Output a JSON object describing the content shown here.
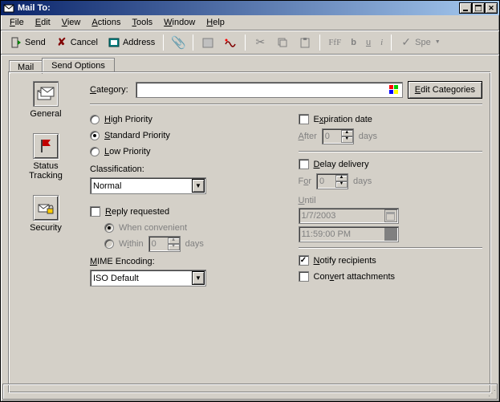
{
  "title": "Mail To:",
  "menu": {
    "file": "File",
    "edit": "Edit",
    "view": "View",
    "actions": "Actions",
    "tools": "Tools",
    "window": "Window",
    "help": "Help"
  },
  "toolbar": {
    "send": "Send",
    "cancel": "Cancel",
    "address": "Address",
    "spell": "Spe"
  },
  "tabs": {
    "mail": "Mail",
    "send_options": "Send Options"
  },
  "sidenav": {
    "general": "General",
    "status": "Status Tracking",
    "security": "Security"
  },
  "category": {
    "label": "Category:",
    "value": "",
    "edit": "Edit Categories"
  },
  "priority": {
    "high": "High Priority",
    "standard": "Standard Priority",
    "low": "Low Priority"
  },
  "classification": {
    "label": "Classification:",
    "value": "Normal"
  },
  "reply": {
    "label": "Reply requested",
    "when": "When convenient",
    "within": "Within",
    "within_val": "0",
    "days": "days"
  },
  "mime": {
    "label": "MIME Encoding:",
    "value": "ISO Default"
  },
  "expiration": {
    "label": "Expiration date",
    "after": "After",
    "after_val": "0",
    "days": "days"
  },
  "delay": {
    "label": "Delay delivery",
    "for": "For",
    "for_val": "0",
    "days": "days",
    "until": "Until",
    "date": "1/7/2003",
    "time": "11:59:00 PM"
  },
  "notify": {
    "label": "Notify recipients"
  },
  "convert": {
    "label": "Convert attachments"
  }
}
